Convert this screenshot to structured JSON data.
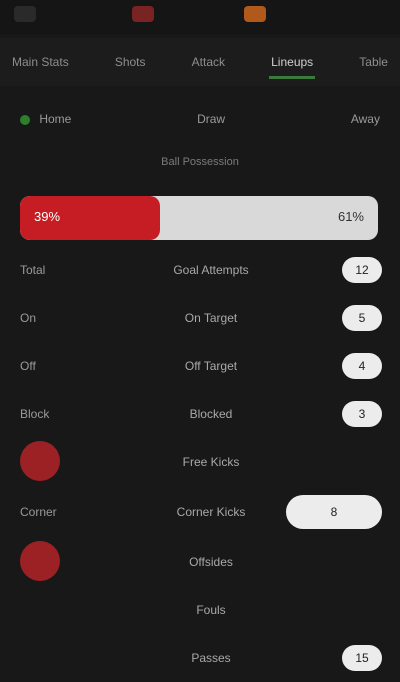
{
  "topbar": {
    "icons": [
      "menu-icon",
      "record-icon",
      "flame-icon"
    ]
  },
  "nav": {
    "tabs": [
      {
        "label": "Main Stats"
      },
      {
        "label": "Shots"
      },
      {
        "label": "Attack"
      },
      {
        "label": "Lineups"
      },
      {
        "label": "Table"
      }
    ],
    "active_index": 3
  },
  "subheader": {
    "left": "Home",
    "center": "Draw",
    "right": "Away"
  },
  "section": {
    "label": "Ball Possession"
  },
  "scorebar": {
    "left": "39%",
    "right": "61%",
    "left_fraction": 0.39
  },
  "rows": [
    {
      "left": "Total",
      "center": "Goal Attempts",
      "right": "12"
    },
    {
      "left": "On",
      "center": "On Target",
      "right": "5"
    },
    {
      "left": "Off",
      "center": "Off Target",
      "right": "4"
    },
    {
      "left": "Block",
      "center": "Blocked",
      "right": "3"
    },
    {
      "left": "",
      "center": "Free Kicks",
      "right": ""
    },
    {
      "left": "Corner",
      "center": "Corner Kicks",
      "right": "8"
    },
    {
      "left": "",
      "center": "Offsides",
      "right": ""
    },
    {
      "left": "",
      "center": "Fouls",
      "right": ""
    },
    {
      "left": "",
      "center": "Passes",
      "right": "15"
    }
  ]
}
